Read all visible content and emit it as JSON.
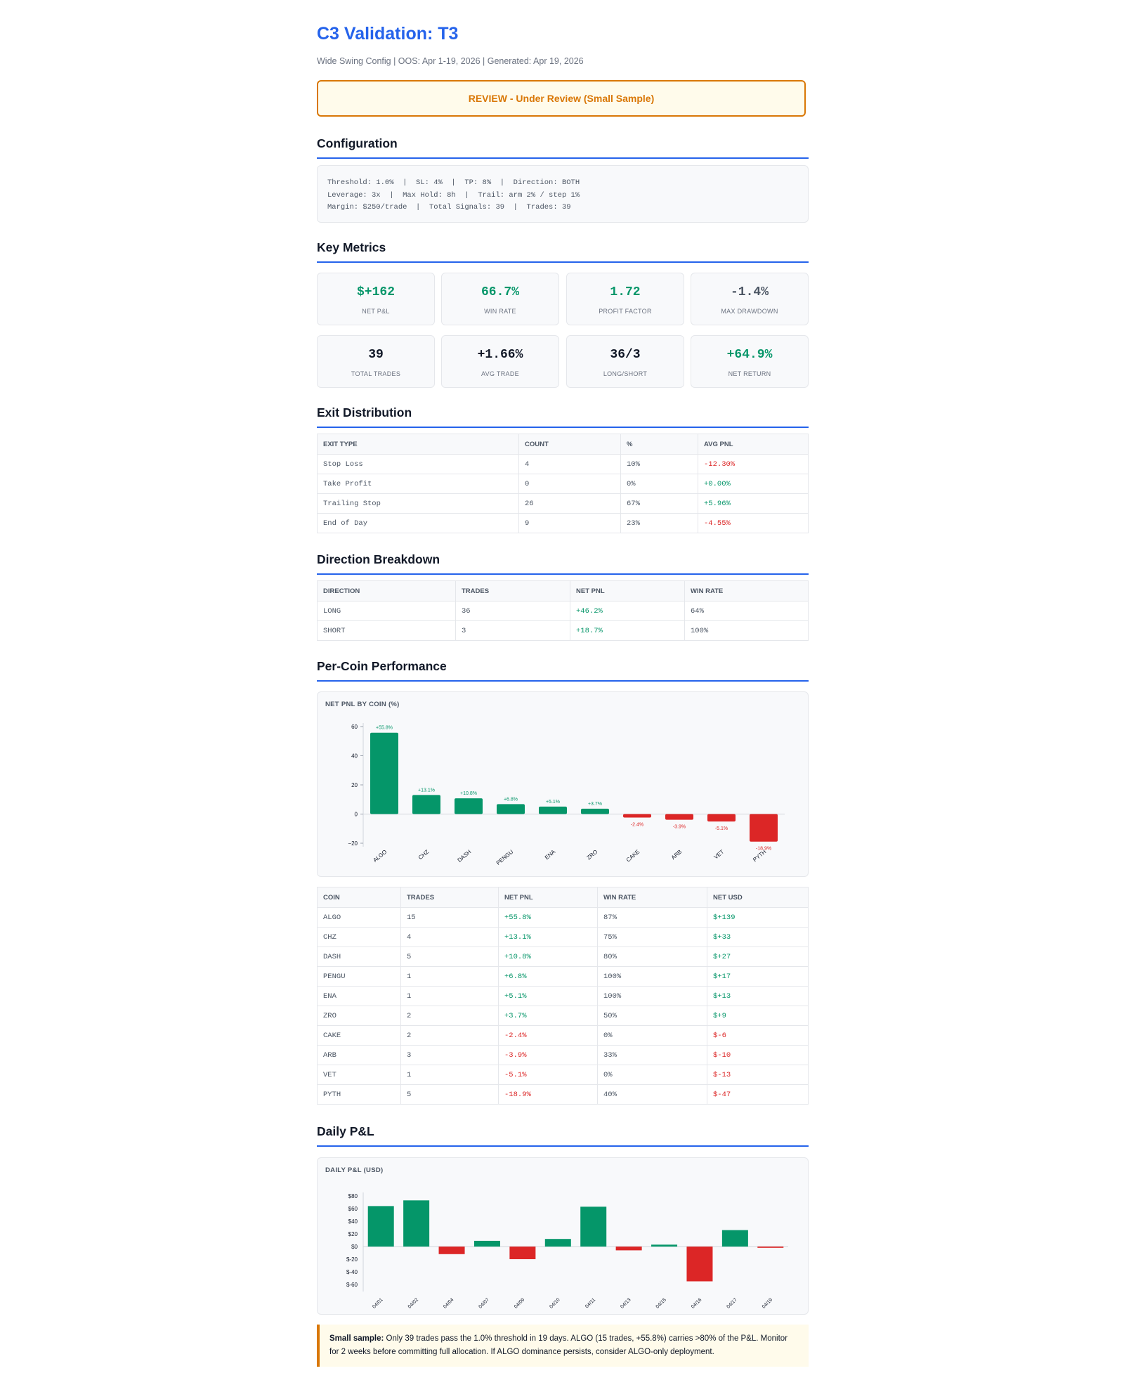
{
  "header": {
    "title": "C3 Validation: T3",
    "subtitle": "Wide Swing Config | OOS: Apr 1-19, 2026 | Generated: Apr 19, 2026",
    "banner": "REVIEW - Under Review (Small Sample)"
  },
  "sections": {
    "configuration": "Configuration",
    "key_metrics": "Key Metrics",
    "exit_distribution": "Exit Distribution",
    "direction_breakdown": "Direction Breakdown",
    "per_coin": "Per-Coin Performance",
    "daily_pnl": "Daily P&L"
  },
  "config": {
    "line1": "Threshold: 1.0%  |  SL: 4%  |  TP: 8%  |  Direction: BOTH",
    "line2": "Leverage: 3x  |  Max Hold: 8h  |  Trail: arm 2% / step 1%",
    "line3": "Margin: $250/trade  |  Total Signals: 39  |  Trades: 39"
  },
  "metrics": [
    {
      "value": "$+162",
      "label": "NET P&L",
      "tone": "pos"
    },
    {
      "value": "66.7%",
      "label": "WIN RATE",
      "tone": "pos"
    },
    {
      "value": "1.72",
      "label": "PROFIT FACTOR",
      "tone": "pos"
    },
    {
      "value": "-1.4%",
      "label": "MAX DRAWDOWN",
      "tone": "muted"
    },
    {
      "value": "39",
      "label": "TOTAL TRADES",
      "tone": "neutral"
    },
    {
      "value": "+1.66%",
      "label": "AVG TRADE",
      "tone": "neutral"
    },
    {
      "value": "36/3",
      "label": "LONG/SHORT",
      "tone": "neutral"
    },
    {
      "value": "+64.9%",
      "label": "NET RETURN",
      "tone": "pos"
    }
  ],
  "exit_table": {
    "headers": [
      "EXIT TYPE",
      "COUNT",
      "%",
      "AVG PNL"
    ],
    "rows": [
      [
        "Stop Loss",
        "4",
        "10%",
        "-12.30%"
      ],
      [
        "Take Profit",
        "0",
        "0%",
        "+0.00%"
      ],
      [
        "Trailing Stop",
        "26",
        "67%",
        "+5.96%"
      ],
      [
        "End of Day",
        "9",
        "23%",
        "-4.55%"
      ]
    ]
  },
  "direction_table": {
    "headers": [
      "DIRECTION",
      "TRADES",
      "NET PNL",
      "WIN RATE"
    ],
    "rows": [
      [
        "LONG",
        "36",
        "+46.2%",
        "64%"
      ],
      [
        "SHORT",
        "3",
        "+18.7%",
        "100%"
      ]
    ]
  },
  "coin_table": {
    "headers": [
      "COIN",
      "TRADES",
      "NET PNL",
      "WIN RATE",
      "NET USD"
    ],
    "rows": [
      [
        "ALGO",
        "15",
        "+55.8%",
        "87%",
        "$+139"
      ],
      [
        "CHZ",
        "4",
        "+13.1%",
        "75%",
        "$+33"
      ],
      [
        "DASH",
        "5",
        "+10.8%",
        "80%",
        "$+27"
      ],
      [
        "PENGU",
        "1",
        "+6.8%",
        "100%",
        "$+17"
      ],
      [
        "ENA",
        "1",
        "+5.1%",
        "100%",
        "$+13"
      ],
      [
        "ZRO",
        "2",
        "+3.7%",
        "50%",
        "$+9"
      ],
      [
        "CAKE",
        "2",
        "-2.4%",
        "0%",
        "$-6"
      ],
      [
        "ARB",
        "3",
        "-3.9%",
        "33%",
        "$-10"
      ],
      [
        "VET",
        "1",
        "-5.1%",
        "0%",
        "$-13"
      ],
      [
        "PYTH",
        "5",
        "-18.9%",
        "40%",
        "$-47"
      ]
    ]
  },
  "colors": {
    "positive": "#059669",
    "negative": "#dc2626",
    "accent": "#2563eb",
    "warning": "#d97706"
  },
  "chart_data": [
    {
      "type": "bar",
      "title": "NET PNL BY COIN (%)",
      "categories": [
        "ALGO",
        "CHZ",
        "DASH",
        "PENGU",
        "ENA",
        "ZRO",
        "CAKE",
        "ARB",
        "VET",
        "PYTH"
      ],
      "values": [
        55.8,
        13.1,
        10.8,
        6.8,
        5.1,
        3.7,
        -2.4,
        -3.9,
        -5.1,
        -18.9
      ],
      "data_labels": [
        "+55.8%",
        "+13.1%",
        "+10.8%",
        "+6.8%",
        "+5.1%",
        "+3.7%",
        "-2.4%",
        "-3.9%",
        "-5.1%",
        "-18.9%"
      ],
      "yticks": [
        60,
        40,
        20,
        0,
        -20
      ],
      "ytick_labels": [
        "60",
        "40",
        "20",
        "0",
        "−20"
      ],
      "ylim": [
        -20,
        60
      ],
      "xlabel": "",
      "ylabel": ""
    },
    {
      "type": "bar",
      "title": "DAILY P&L (USD)",
      "categories": [
        "04/01",
        "04/02",
        "04/04",
        "04/07",
        "04/09",
        "04/10",
        "04/11",
        "04/13",
        "04/15",
        "04/16",
        "04/17",
        "04/19"
      ],
      "values": [
        64,
        73,
        -12,
        9,
        -20,
        12,
        63,
        -6,
        3,
        -55,
        26,
        -2
      ],
      "yticks": [
        80,
        60,
        40,
        20,
        0,
        -20,
        -40,
        -60
      ],
      "ytick_labels": [
        "$80",
        "$60",
        "$40",
        "$20",
        "$0",
        "$-20",
        "$-40",
        "$-60"
      ],
      "ylim": [
        -60,
        80
      ],
      "xlabel": "",
      "ylabel": ""
    }
  ],
  "note": {
    "bold": "Small sample:",
    "text": " Only 39 trades pass the 1.0% threshold in 19 days. ALGO (15 trades, +55.8%) carries >80% of the P&L. Monitor for 2 weeks before committing full allocation. If ALGO dominance persists, consider ALGO-only deployment."
  }
}
